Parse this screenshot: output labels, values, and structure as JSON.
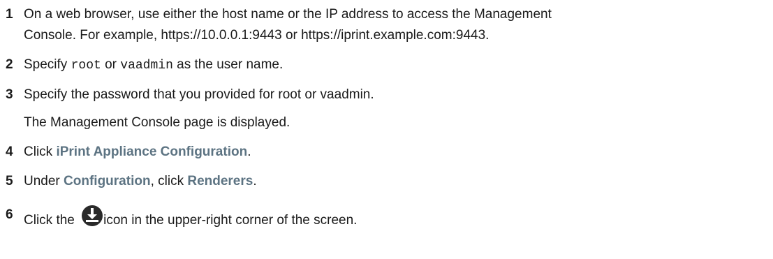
{
  "steps": [
    {
      "number": "1",
      "text_line1": "On a web browser, use either the host name or the IP address to access the Management",
      "text_line2": "Console. For example, https://10.0.0.1:9443 or https://iprint.example.com:9443."
    },
    {
      "number": "2",
      "prefix": "Specify ",
      "code1": "root",
      "mid": " or ",
      "code2": "vaadmin",
      "suffix": " as the user name."
    },
    {
      "number": "3",
      "text": "Specify the password that you provided for root or vaadmin.",
      "result": "The Management Console page is displayed."
    },
    {
      "number": "4",
      "prefix": "Click ",
      "ui_label": "iPrint Appliance Configuration",
      "suffix": "."
    },
    {
      "number": "5",
      "prefix": "Under ",
      "ui_label1": "Configuration",
      "mid": ", click ",
      "ui_label2": "Renderers",
      "suffix": "."
    },
    {
      "number": "6",
      "prefix": "Click the ",
      "icon": "download-circle-icon",
      "suffix": "icon in the upper-right corner of the screen."
    }
  ],
  "colors": {
    "text": "#1a1a1a",
    "ui_label": "#5c7382",
    "icon_fill": "#2a2a2a"
  }
}
